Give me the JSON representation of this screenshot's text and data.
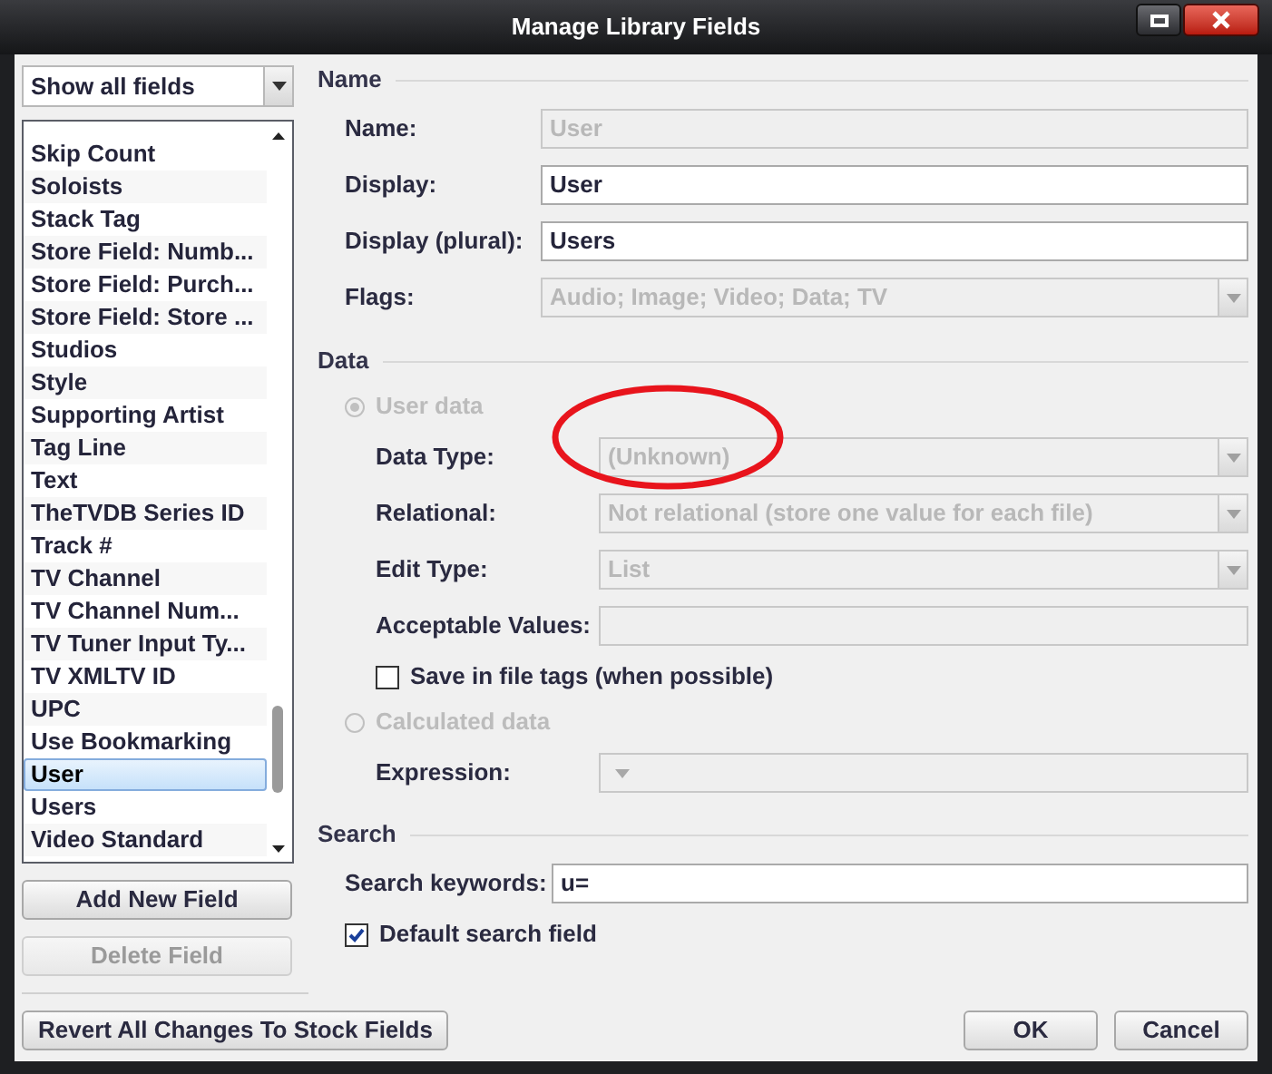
{
  "window": {
    "title": "Manage Library Fields"
  },
  "filter": {
    "value": "Show all fields"
  },
  "fields_list": {
    "items": [
      {
        "label": "Skip Count",
        "selected": false
      },
      {
        "label": "Soloists",
        "selected": false
      },
      {
        "label": "Stack Tag",
        "selected": false
      },
      {
        "label": "Store Field: Numb...",
        "selected": false
      },
      {
        "label": "Store Field: Purch...",
        "selected": false
      },
      {
        "label": "Store Field: Store ...",
        "selected": false
      },
      {
        "label": "Studios",
        "selected": false
      },
      {
        "label": "Style",
        "selected": false
      },
      {
        "label": "Supporting Artist",
        "selected": false
      },
      {
        "label": "Tag Line",
        "selected": false
      },
      {
        "label": "Text",
        "selected": false
      },
      {
        "label": "TheTVDB Series ID",
        "selected": false
      },
      {
        "label": "Track #",
        "selected": false
      },
      {
        "label": "TV Channel",
        "selected": false
      },
      {
        "label": "TV Channel Num...",
        "selected": false
      },
      {
        "label": "TV Tuner Input Ty...",
        "selected": false
      },
      {
        "label": "TV XMLTV ID",
        "selected": false
      },
      {
        "label": "UPC",
        "selected": false
      },
      {
        "label": "Use Bookmarking",
        "selected": false
      },
      {
        "label": "User",
        "selected": true
      },
      {
        "label": "Users",
        "selected": false
      },
      {
        "label": "Video Standard",
        "selected": false
      }
    ]
  },
  "list_buttons": [
    {
      "label": "Add New Field",
      "disabled": false
    },
    {
      "label": "Delete Field",
      "disabled": true
    }
  ],
  "sections": [
    {
      "title": "Name",
      "items": [
        {
          "kind": "text_field",
          "label": "Name:",
          "value": "User",
          "disabled": true
        },
        {
          "kind": "text_field",
          "label": "Display:",
          "value": "User",
          "disabled": false
        },
        {
          "kind": "text_field",
          "label": "Display (plural):",
          "value": "Users",
          "disabled": false
        },
        {
          "kind": "dropdown",
          "label": "Flags:",
          "value": "Audio; Image; Video; Data; TV",
          "disabled": true
        }
      ]
    },
    {
      "title": "Data",
      "items": [
        {
          "kind": "radio",
          "label": "User data",
          "selected": true,
          "disabled": true
        },
        {
          "kind": "dropdown",
          "label": "Data Type:",
          "value": "(Unknown)",
          "disabled": true
        },
        {
          "kind": "dropdown",
          "label": "Relational:",
          "value": "Not relational (store one value for each file)",
          "disabled": true
        },
        {
          "kind": "dropdown",
          "label": "Edit Type:",
          "value": "List",
          "disabled": true
        },
        {
          "kind": "text_field",
          "label": "Acceptable Values:",
          "disabled": true
        },
        {
          "kind": "checkbox",
          "label": "Save in file tags (when possible)",
          "checked": false
        },
        {
          "kind": "radio",
          "label": "Calculated data",
          "selected": false,
          "disabled": true
        },
        {
          "kind": "expression_field",
          "label": "Expression:",
          "disabled": true
        }
      ]
    },
    {
      "title": "Search",
      "items": [
        {
          "kind": "text_field",
          "label": "Search keywords:",
          "value": "u=",
          "disabled": false
        },
        {
          "kind": "checkbox",
          "label": "Default search field",
          "checked": true
        }
      ]
    }
  ],
  "footer_buttons": [
    {
      "label": "Revert All Changes To Stock Fields"
    }
  ],
  "dialog_buttons": [
    {
      "label": "OK"
    },
    {
      "label": "Cancel"
    }
  ],
  "annotation": {
    "kind": "ellipse"
  }
}
